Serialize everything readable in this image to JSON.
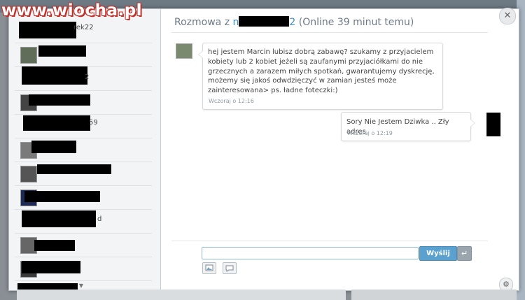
{
  "watermark": "www.wiocha.pl",
  "chat": {
    "header_prefix": "Rozmowa z ",
    "header_name_start": "n",
    "header_name_end": "2",
    "header_status": " (Online 39 minut temu)"
  },
  "contacts": [
    {
      "tail": "rek22"
    },
    {
      "tail": ""
    },
    {
      "tail": "2"
    },
    {
      "tail": ""
    },
    {
      "tail": "59"
    },
    {
      "tail": ""
    },
    {
      "tail": ""
    },
    {
      "tail": ""
    },
    {
      "tail": "d"
    },
    {
      "tail": ""
    },
    {
      "tail": ""
    }
  ],
  "messages": [
    {
      "side": "left",
      "text": "hej jestem Marcin lubisz dobrą zabawę? szukamy z przyjacielem kobiety lub 2 kobiet jeżeli są zaufanymi przyjaciółkami do nie grzecznych a zarazem miłych spotkań, gwarantujemy dyskrecję, możemy się jakoś odwdzięczyć w zamian jesteś może zainteresowana> ps. ładne foteczki:)",
      "time": "Wczoraj o 12:16"
    },
    {
      "side": "right",
      "text": "Sory Nie Jestem Dziwka .. Zły adres",
      "time": "Wczoraj o 12:19"
    }
  ],
  "compose": {
    "input_value": "",
    "send_label": "Wyślij"
  },
  "icons": {
    "close": "close-icon",
    "enter": "enter-icon",
    "image": "image-icon",
    "emoticon": "emoticon-icon",
    "settings": "gear-icon"
  },
  "colors": {
    "send_button": "#5aa1cf",
    "header_text": "#6c7a88",
    "timestamp": "#8e9aa6"
  }
}
